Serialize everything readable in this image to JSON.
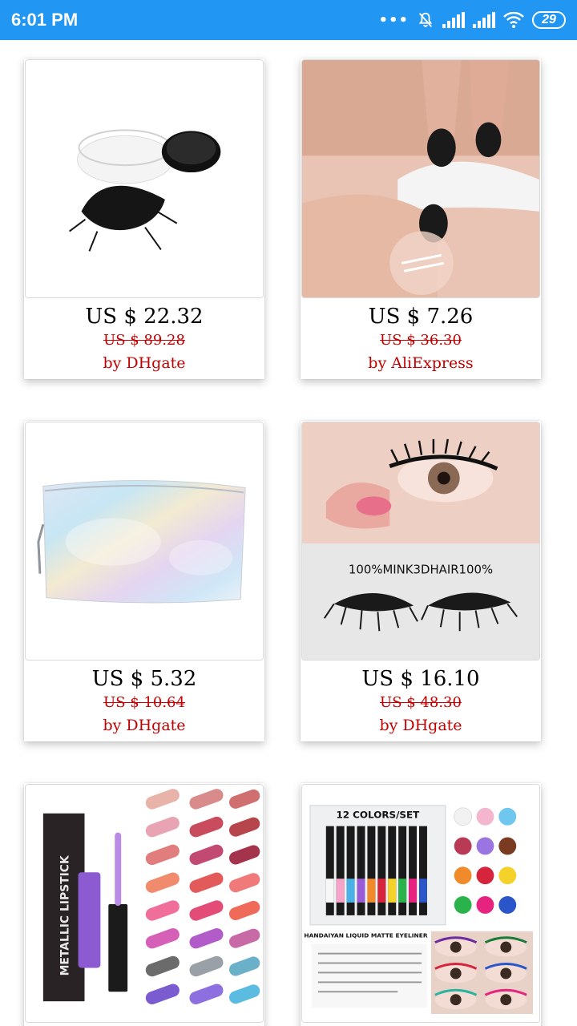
{
  "status_bar": {
    "time": "6:01 PM",
    "battery": "29",
    "icons": [
      "more-dots-icon",
      "muted-bell-icon",
      "signal-icon",
      "signal-icon",
      "wifi-icon",
      "battery-icon"
    ]
  },
  "colors": {
    "status_bar": "#2196f3",
    "seller_text": "#c40000",
    "old_price": "#c40000"
  },
  "products": [
    {
      "image": "eyelash-extensions-jar",
      "price": "US $ 22.32",
      "old_price": "US $ 89.28",
      "seller": "by DHgate"
    },
    {
      "image": "lash-lift-application",
      "price": "US $ 7.26",
      "old_price": "US $ 36.30",
      "seller": "by AliExpress"
    },
    {
      "image": "holographic-cosmetic-bag",
      "price": "US $ 5.32",
      "old_price": "US $ 10.64",
      "seller": "by DHgate"
    },
    {
      "image": "mink-3d-hair-lashes",
      "price": "US $ 16.10",
      "old_price": "US $ 48.30",
      "seller": "by DHgate",
      "image_text": "100%MINK3DHAIR100%"
    },
    {
      "image": "metallic-lipstick-swatches",
      "image_text": "METALLIC LIPSTICK"
    },
    {
      "image": "liquid-eyeliner-set",
      "image_text": "12 COLORS/SET",
      "image_caption": "HANDAIYAN LIQUID MATTE EYELINER"
    }
  ]
}
